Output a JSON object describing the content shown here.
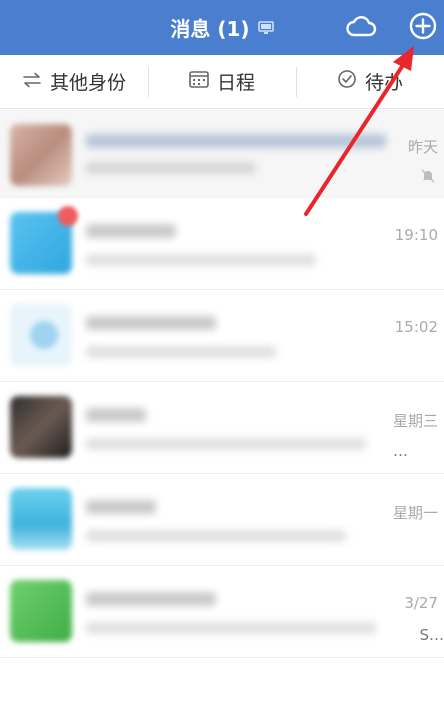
{
  "header": {
    "title": "消息 (1)",
    "icons": [
      "monitor-icon",
      "cloud-icon",
      "plus-circle-icon"
    ],
    "color": "#4a7fd0"
  },
  "tabs": [
    {
      "label": "其他身份",
      "icon": "switch-arrows-icon"
    },
    {
      "label": "日程",
      "icon": "calendar-icon"
    },
    {
      "label": "待办",
      "icon": "check-circle-icon"
    }
  ],
  "conversations": [
    {
      "time": "昨天",
      "muted": true,
      "avatar_color": "#caa79a"
    },
    {
      "time": "19:10",
      "badge": true,
      "avatar_color": "#43b4e8"
    },
    {
      "time": "15:02",
      "avatar_color": "#cfe8f7"
    },
    {
      "time": "星期三",
      "ellipsis": "…",
      "avatar_color": "#4a4a4a"
    },
    {
      "time": "星期一",
      "avatar_color": "#5cc3e6"
    },
    {
      "time": "3/27",
      "side": "S…",
      "avatar_color": "#58c25b"
    }
  ],
  "annotation": {
    "arrow_color": "#e8262b"
  }
}
